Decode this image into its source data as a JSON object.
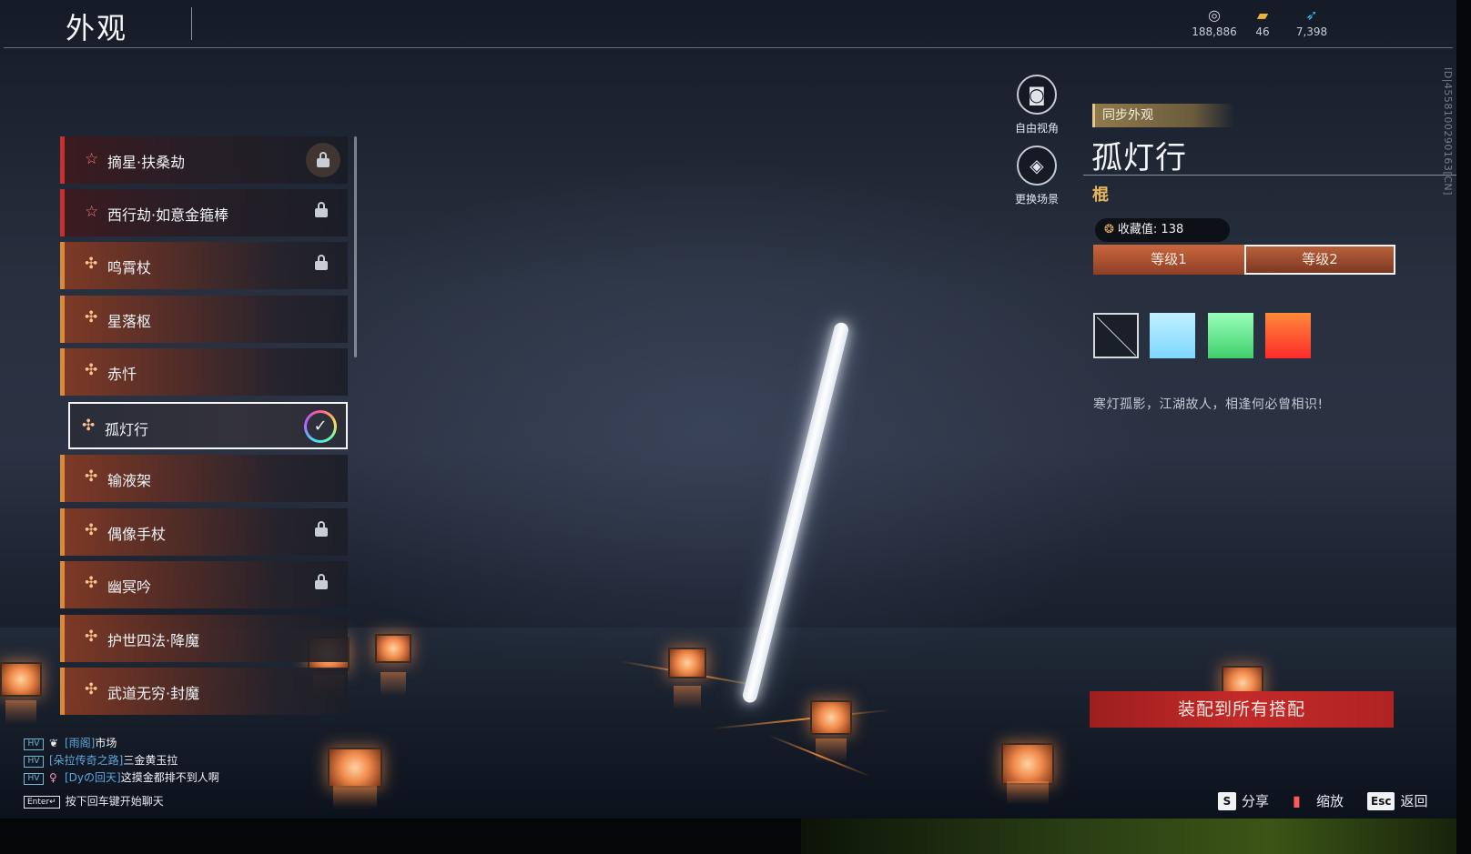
{
  "header": {
    "title": "外观",
    "currencies": [
      {
        "icon": "coin-icon",
        "value": "188,886"
      },
      {
        "icon": "ticket-icon",
        "value": "46"
      },
      {
        "icon": "feather-icon",
        "value": "7,398"
      }
    ]
  },
  "vertical_id": "ID|4558100290163[CN]",
  "list": {
    "items": [
      {
        "name": "摘星·扶桑劫",
        "icon": "star-icon",
        "locked": true
      },
      {
        "name": "西行劫·如意金箍棒",
        "icon": "star-icon",
        "locked": true
      },
      {
        "name": "鸣霄杖",
        "icon": "flower-icon",
        "locked": true
      },
      {
        "name": "星落枢",
        "icon": "flower-icon",
        "locked": false
      },
      {
        "name": "赤忏",
        "icon": "flower-icon",
        "locked": false
      },
      {
        "name": "孤灯行",
        "icon": "flower-icon",
        "locked": false,
        "selected": true
      },
      {
        "name": "输液架",
        "icon": "flower-icon",
        "locked": false
      },
      {
        "name": "偶像手杖",
        "icon": "flower-icon",
        "locked": true
      },
      {
        "name": "幽冥吟",
        "icon": "flower-icon",
        "locked": true
      },
      {
        "name": "护世四法·降魔",
        "icon": "flower-icon",
        "locked": false
      },
      {
        "name": "武道无穷·封魔",
        "icon": "flower-icon",
        "locked": false
      }
    ]
  },
  "camera": {
    "free_view": "自由视角",
    "change_scene": "更换场景"
  },
  "detail": {
    "sync_label": "同步外观",
    "title": "孤灯行",
    "type": "棍",
    "collect_label": "收藏值: 138",
    "levels": [
      "等级1",
      "等级2"
    ],
    "selected_level": "等级2",
    "colors": [
      "none",
      "#9fe3ff",
      "#6fe896",
      "#ff4a2a"
    ],
    "description": "寒灯孤影，江湖故人，相逢何必曾相识!"
  },
  "equip_button": "装配到所有搭配",
  "hotkeys": [
    {
      "key": "S",
      "label": "分享"
    },
    {
      "key": "",
      "label": "缩放"
    },
    {
      "key": "Esc",
      "label": "返回"
    }
  ],
  "chat": {
    "lines": [
      {
        "badge": "HV",
        "sym": "❦",
        "channel": "[雨阁]",
        "text": "市场"
      },
      {
        "badge": "HV",
        "sym": "",
        "channel": "[朵拉传奇之路]",
        "text": "三金黄玉拉"
      },
      {
        "badge": "HV",
        "sym": "♀",
        "channel": "[Dyの回天]",
        "text": "这摸金都排不到人啊"
      }
    ],
    "enter_key": "Enter↵",
    "hint": "按下回车键开始聊天"
  }
}
